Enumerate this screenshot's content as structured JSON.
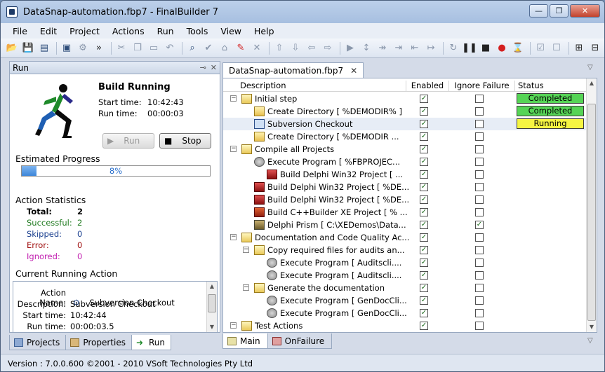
{
  "window": {
    "title": "DataSnap-automation.fbp7 - FinalBuilder 7",
    "buttons": {
      "minimize": "—",
      "maximize": "❐",
      "close": "✕"
    }
  },
  "menu": [
    "File",
    "Edit",
    "Project",
    "Actions",
    "Run",
    "Tools",
    "View",
    "Help"
  ],
  "toolbar": {
    "icons": [
      "open-folder-icon",
      "save-icon",
      "new-icon",
      "options-icon",
      "tools-icon",
      "cut-icon",
      "copy-icon",
      "paste-icon",
      "undo-icon",
      "find-icon",
      "check-icon",
      "tag-icon",
      "magic-icon",
      "delete-icon",
      "move-up-icon",
      "move-down-icon",
      "move-left-icon",
      "move-right-icon",
      "play-icon",
      "step-icon",
      "step-over-icon",
      "step-into-icon",
      "step-out-icon",
      "refresh-icon",
      "pause-icon",
      "stop-icon",
      "record-icon",
      "hourglass-icon",
      "checkbox-icon",
      "checkbox-empty-icon",
      "expand-icon",
      "collapse-icon"
    ]
  },
  "run_panel": {
    "title": "Run",
    "build_status": "Build Running",
    "start_time_label": "Start time:",
    "start_time": "10:42:43",
    "run_time_label": "Run time:",
    "run_time": "00:00:03",
    "run_button": "Run",
    "stop_button": "Stop",
    "progress_title": "Estimated Progress",
    "progress_percent": 8,
    "progress_text": "8%",
    "stats_title": "Action Statistics",
    "stats": [
      {
        "label": "Total:",
        "value": "2",
        "color": "#000000"
      },
      {
        "label": "Successful:",
        "value": "2",
        "color": "#1f7a1f"
      },
      {
        "label": "Skipped:",
        "value": "0",
        "color": "#1a3f8f"
      },
      {
        "label": "Error:",
        "value": "0",
        "color": "#a01010"
      },
      {
        "label": "Ignored:",
        "value": "0",
        "color": "#c21fb0"
      }
    ],
    "current_title": "Current Running Action",
    "current": {
      "action_name_label": "Action Name:",
      "action_name": "Subversion Checkout",
      "description_label": "Description:",
      "description": "Subversion Checkout",
      "start_time_label": "Start time:",
      "start_time": "10:42:44",
      "run_time_label": "Run time:",
      "run_time": "00:00:03.5"
    }
  },
  "left_tabs": [
    "Projects",
    "Properties",
    "Run"
  ],
  "doc_tab": "DataSnap-automation.fbp7",
  "grid": {
    "columns": [
      "Description",
      "Enabled",
      "Ignore Failure",
      "Status"
    ],
    "rows": [
      {
        "level": 0,
        "icon": "group-icon",
        "label": "Initial step",
        "enabled": true,
        "ignore": false,
        "status": "Completed",
        "status_color": "#56d456"
      },
      {
        "level": 1,
        "icon": "create-directory-icon",
        "label": "Create Directory [ %DEMODIR% ]",
        "enabled": true,
        "ignore": false,
        "status": "Completed",
        "status_color": "#56d456"
      },
      {
        "level": 1,
        "icon": "subversion-icon",
        "label": "Subversion Checkout",
        "enabled": true,
        "ignore": false,
        "status": "Running",
        "status_color": "#f5f542"
      },
      {
        "level": 1,
        "icon": "create-directory-icon",
        "label": "Create Directory [ %DEMODIR ...",
        "enabled": true,
        "ignore": false,
        "status": "",
        "status_color": ""
      },
      {
        "level": 0,
        "icon": "group-icon",
        "label": "Compile all Projects",
        "enabled": true,
        "ignore": false,
        "status": "",
        "status_color": ""
      },
      {
        "level": 1,
        "icon": "execute-program-icon",
        "label": "Execute Program [ %FBPROJEC...",
        "enabled": true,
        "ignore": false,
        "status": "",
        "status_color": ""
      },
      {
        "level": 2,
        "icon": "delphi-icon",
        "label": "Build Delphi Win32 Project [ ...",
        "enabled": true,
        "ignore": false,
        "status": "",
        "status_color": ""
      },
      {
        "level": 1,
        "icon": "delphi-icon",
        "label": "Build Delphi Win32 Project [ %DE...",
        "enabled": true,
        "ignore": false,
        "status": "",
        "status_color": ""
      },
      {
        "level": 1,
        "icon": "delphi-icon",
        "label": "Build Delphi Win32 Project [ %DE...",
        "enabled": true,
        "ignore": false,
        "status": "",
        "status_color": ""
      },
      {
        "level": 1,
        "icon": "cbuilder-icon",
        "label": "Build C++Builder XE Project [ % ...",
        "enabled": true,
        "ignore": false,
        "status": "",
        "status_color": ""
      },
      {
        "level": 1,
        "icon": "delphi-prism-icon",
        "label": "Delphi Prism [ C:\\XEDemos\\Data...",
        "enabled": true,
        "ignore": true,
        "status": "",
        "status_color": ""
      },
      {
        "level": 0,
        "icon": "group-icon",
        "label": "Documentation and Code Quality Ac...",
        "enabled": true,
        "ignore": false,
        "status": "",
        "status_color": ""
      },
      {
        "level": 1,
        "icon": "group-icon",
        "label": "Copy required files for audits an...",
        "enabled": true,
        "ignore": false,
        "status": "",
        "status_color": ""
      },
      {
        "level": 2,
        "icon": "execute-program-icon",
        "label": "Execute Program [ Auditscli....",
        "enabled": true,
        "ignore": false,
        "status": "",
        "status_color": ""
      },
      {
        "level": 2,
        "icon": "execute-program-icon",
        "label": "Execute Program [ Auditscli....",
        "enabled": true,
        "ignore": false,
        "status": "",
        "status_color": ""
      },
      {
        "level": 1,
        "icon": "group-icon",
        "label": "Generate the documentation",
        "enabled": true,
        "ignore": false,
        "status": "",
        "status_color": ""
      },
      {
        "level": 2,
        "icon": "execute-program-icon",
        "label": "Execute Program [ GenDocCli...",
        "enabled": true,
        "ignore": false,
        "status": "",
        "status_color": ""
      },
      {
        "level": 2,
        "icon": "execute-program-icon",
        "label": "Execute Program [ GenDocCli...",
        "enabled": true,
        "ignore": false,
        "status": "",
        "status_color": ""
      },
      {
        "level": 0,
        "icon": "group-icon",
        "label": "Test Actions",
        "enabled": true,
        "ignore": false,
        "status": "",
        "status_color": ""
      }
    ]
  },
  "right_tabs": [
    "Main",
    "OnFailure"
  ],
  "statusbar": "Version :  7.0.0.600    ©2001 - 2010 VSoft Technologies Pty Ltd"
}
